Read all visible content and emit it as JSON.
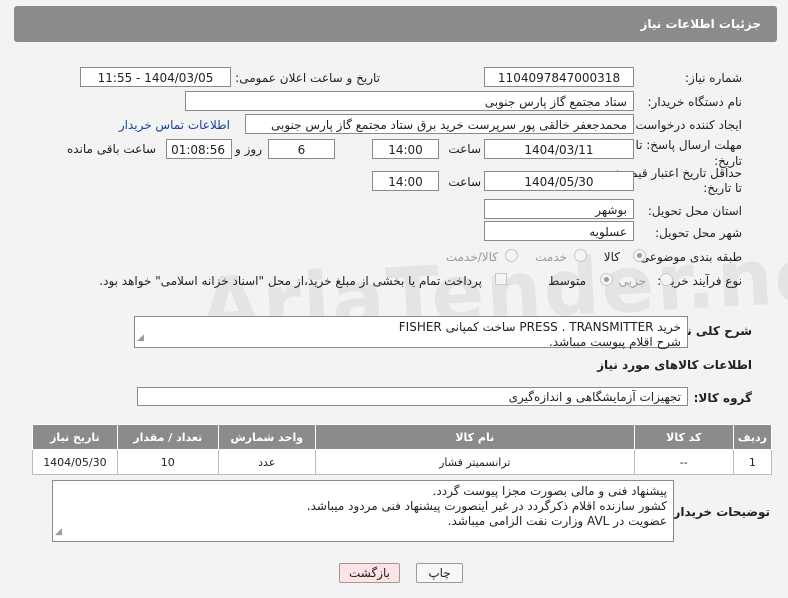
{
  "header": {
    "title": "جزئیات اطلاعات نیاز"
  },
  "fields": {
    "need_number_label": "شماره نیاز:",
    "need_number": "1104097847000318",
    "announce_label": "تاریخ و ساعت اعلان عمومی:",
    "announce_value": "1404/03/05 - 11:55",
    "buyer_org_label": "نام دستگاه خریدار:",
    "buyer_org": "ستاد مجتمع گاز پارس جنوبی",
    "requester_label": "ایجاد کننده درخواست:",
    "requester": "محمدجعفر خالقی پور سرپرست خرید برق ستاد مجتمع گاز پارس جنوبی",
    "buyer_contact_link": "اطلاعات تماس خریدار",
    "reply_deadline_label_1": "مهلت ارسال پاسخ: تا",
    "reply_deadline_label_2": "تاریخ:",
    "reply_date": "1404/03/11",
    "time_label": "ساعت",
    "reply_time": "14:00",
    "days_value": "6",
    "days_label": "روز و",
    "remaining_time": "01:08:56",
    "remaining_label": "ساعت باقی مانده",
    "min_validity_label_1": "حداقل تاریخ اعتبار قیمت:",
    "min_validity_label_2": "تا تاریخ:",
    "validity_date": "1404/05/30",
    "validity_time": "14:00",
    "province_label": "استان محل تحویل:",
    "province": "بوشهر",
    "city_label": "شهر محل تحویل:",
    "city": "عسلویه",
    "category_label": "طبقه بندی موضوعی:",
    "category_options": [
      "کالا",
      "خدمت",
      "کالا/خدمت"
    ],
    "process_label": "نوع فرآیند خرید :",
    "process_options": [
      "جزیی",
      "متوسط"
    ],
    "payment_note": "پرداخت تمام یا بخشی از مبلغ خرید،از محل \"اسناد خزانه اسلامی\" خواهد بود."
  },
  "description": {
    "label": "شرح کلی نیاز:",
    "line1": "خرید PRESS . TRANSMITTER ساخت کمپانی FISHER",
    "line2": "شرح اقلام پیوست میباشد."
  },
  "goods_section": {
    "title": "اطلاعات کالاهای مورد نیاز",
    "group_label": "گروه کالا:",
    "group_value": "تجهیزات آزمایشگاهی و اندازه‌گیری"
  },
  "table": {
    "headers": [
      "ردیف",
      "کد کالا",
      "نام کالا",
      "واحد شمارش",
      "تعداد / مقدار",
      "تاریخ نیاز"
    ],
    "rows": [
      [
        "1",
        "--",
        "ترانسمیتر فشار",
        "عدد",
        "10",
        "1404/05/30"
      ]
    ]
  },
  "buyer_notes": {
    "label": "توضیحات خریدار:",
    "line1": "پیشنهاد فنی و مالی بصورت مجزا پیوست گردد.",
    "line2": "کشور سازنده اقلام ذکرگردد در غیر اینصورت پیشنهاد فنی مردود میباشد.",
    "line3": "عضویت در AVL  وزارت نفت الزامی میباشد."
  },
  "buttons": {
    "print": "چاپ",
    "back": "بازگشت"
  },
  "watermark": "AriaTender.neT",
  "colors": {
    "header_bg": "#8b8b8b",
    "link": "#1a3fa8",
    "back_button_bg": "#fde3e3"
  }
}
